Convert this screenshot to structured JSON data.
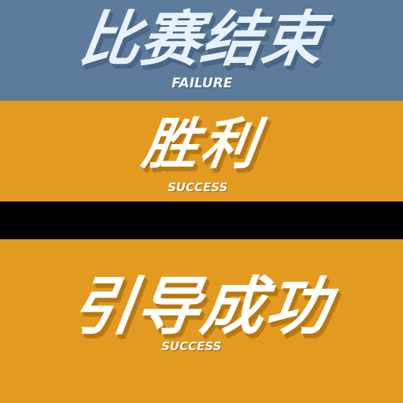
{
  "banners": [
    {
      "title": "比赛结束",
      "subtitle": "FAILURE",
      "background_color": "#5d7b9b",
      "text_color": "#e8f1ff"
    },
    {
      "title": "胜利",
      "subtitle": "SUCCESS",
      "background_color": "#e29b20",
      "text_color": "#ffffff"
    },
    {
      "title": "引导成功",
      "subtitle": "SUCCESS",
      "background_color": "#e29b20",
      "text_color": "#ffffff"
    }
  ],
  "separator_color": "#000000"
}
